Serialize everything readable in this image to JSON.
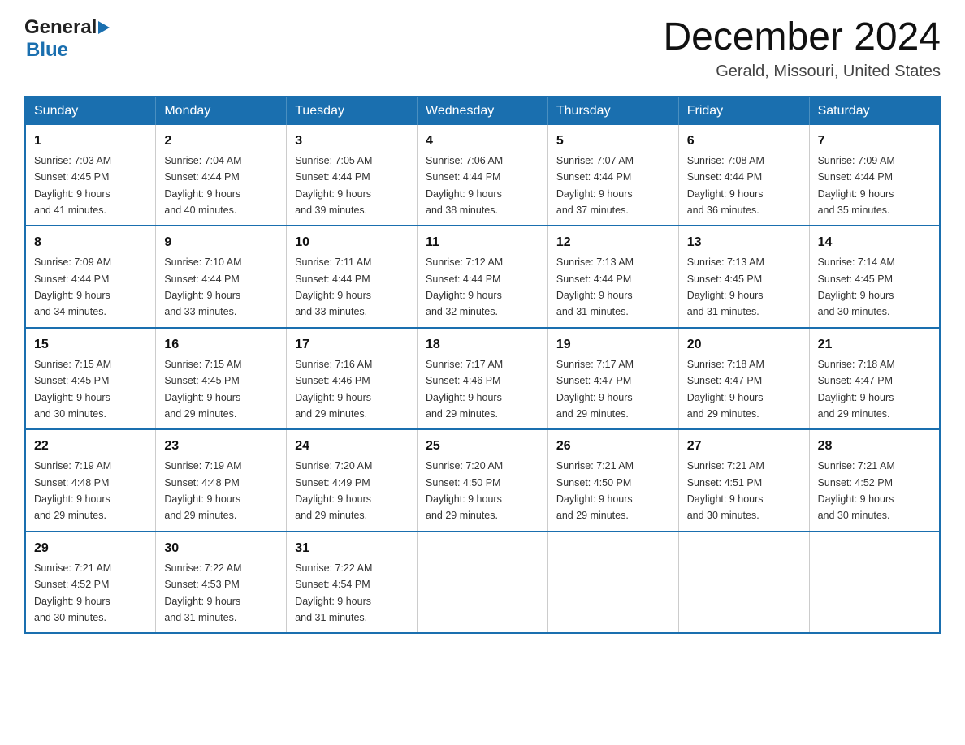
{
  "logo": {
    "general": "General",
    "blue": "Blue"
  },
  "header": {
    "month": "December 2024",
    "location": "Gerald, Missouri, United States"
  },
  "weekdays": [
    "Sunday",
    "Monday",
    "Tuesday",
    "Wednesday",
    "Thursday",
    "Friday",
    "Saturday"
  ],
  "weeks": [
    [
      {
        "day": "1",
        "sunrise": "7:03 AM",
        "sunset": "4:45 PM",
        "daylight": "9 hours and 41 minutes."
      },
      {
        "day": "2",
        "sunrise": "7:04 AM",
        "sunset": "4:44 PM",
        "daylight": "9 hours and 40 minutes."
      },
      {
        "day": "3",
        "sunrise": "7:05 AM",
        "sunset": "4:44 PM",
        "daylight": "9 hours and 39 minutes."
      },
      {
        "day": "4",
        "sunrise": "7:06 AM",
        "sunset": "4:44 PM",
        "daylight": "9 hours and 38 minutes."
      },
      {
        "day": "5",
        "sunrise": "7:07 AM",
        "sunset": "4:44 PM",
        "daylight": "9 hours and 37 minutes."
      },
      {
        "day": "6",
        "sunrise": "7:08 AM",
        "sunset": "4:44 PM",
        "daylight": "9 hours and 36 minutes."
      },
      {
        "day": "7",
        "sunrise": "7:09 AM",
        "sunset": "4:44 PM",
        "daylight": "9 hours and 35 minutes."
      }
    ],
    [
      {
        "day": "8",
        "sunrise": "7:09 AM",
        "sunset": "4:44 PM",
        "daylight": "9 hours and 34 minutes."
      },
      {
        "day": "9",
        "sunrise": "7:10 AM",
        "sunset": "4:44 PM",
        "daylight": "9 hours and 33 minutes."
      },
      {
        "day": "10",
        "sunrise": "7:11 AM",
        "sunset": "4:44 PM",
        "daylight": "9 hours and 33 minutes."
      },
      {
        "day": "11",
        "sunrise": "7:12 AM",
        "sunset": "4:44 PM",
        "daylight": "9 hours and 32 minutes."
      },
      {
        "day": "12",
        "sunrise": "7:13 AM",
        "sunset": "4:44 PM",
        "daylight": "9 hours and 31 minutes."
      },
      {
        "day": "13",
        "sunrise": "7:13 AM",
        "sunset": "4:45 PM",
        "daylight": "9 hours and 31 minutes."
      },
      {
        "day": "14",
        "sunrise": "7:14 AM",
        "sunset": "4:45 PM",
        "daylight": "9 hours and 30 minutes."
      }
    ],
    [
      {
        "day": "15",
        "sunrise": "7:15 AM",
        "sunset": "4:45 PM",
        "daylight": "9 hours and 30 minutes."
      },
      {
        "day": "16",
        "sunrise": "7:15 AM",
        "sunset": "4:45 PM",
        "daylight": "9 hours and 29 minutes."
      },
      {
        "day": "17",
        "sunrise": "7:16 AM",
        "sunset": "4:46 PM",
        "daylight": "9 hours and 29 minutes."
      },
      {
        "day": "18",
        "sunrise": "7:17 AM",
        "sunset": "4:46 PM",
        "daylight": "9 hours and 29 minutes."
      },
      {
        "day": "19",
        "sunrise": "7:17 AM",
        "sunset": "4:47 PM",
        "daylight": "9 hours and 29 minutes."
      },
      {
        "day": "20",
        "sunrise": "7:18 AM",
        "sunset": "4:47 PM",
        "daylight": "9 hours and 29 minutes."
      },
      {
        "day": "21",
        "sunrise": "7:18 AM",
        "sunset": "4:47 PM",
        "daylight": "9 hours and 29 minutes."
      }
    ],
    [
      {
        "day": "22",
        "sunrise": "7:19 AM",
        "sunset": "4:48 PM",
        "daylight": "9 hours and 29 minutes."
      },
      {
        "day": "23",
        "sunrise": "7:19 AM",
        "sunset": "4:48 PM",
        "daylight": "9 hours and 29 minutes."
      },
      {
        "day": "24",
        "sunrise": "7:20 AM",
        "sunset": "4:49 PM",
        "daylight": "9 hours and 29 minutes."
      },
      {
        "day": "25",
        "sunrise": "7:20 AM",
        "sunset": "4:50 PM",
        "daylight": "9 hours and 29 minutes."
      },
      {
        "day": "26",
        "sunrise": "7:21 AM",
        "sunset": "4:50 PM",
        "daylight": "9 hours and 29 minutes."
      },
      {
        "day": "27",
        "sunrise": "7:21 AM",
        "sunset": "4:51 PM",
        "daylight": "9 hours and 30 minutes."
      },
      {
        "day": "28",
        "sunrise": "7:21 AM",
        "sunset": "4:52 PM",
        "daylight": "9 hours and 30 minutes."
      }
    ],
    [
      {
        "day": "29",
        "sunrise": "7:21 AM",
        "sunset": "4:52 PM",
        "daylight": "9 hours and 30 minutes."
      },
      {
        "day": "30",
        "sunrise": "7:22 AM",
        "sunset": "4:53 PM",
        "daylight": "9 hours and 31 minutes."
      },
      {
        "day": "31",
        "sunrise": "7:22 AM",
        "sunset": "4:54 PM",
        "daylight": "9 hours and 31 minutes."
      },
      null,
      null,
      null,
      null
    ]
  ],
  "labels": {
    "sunrise": "Sunrise: ",
    "sunset": "Sunset: ",
    "daylight": "Daylight: "
  }
}
